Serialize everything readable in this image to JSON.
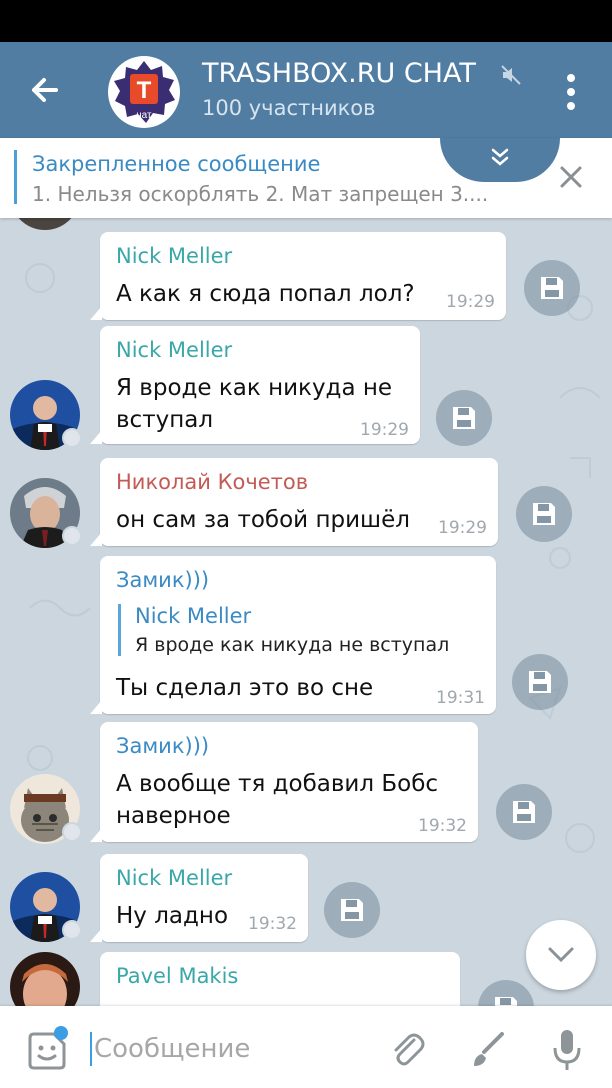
{
  "header": {
    "title": "TRASHBOX.RU CHAT",
    "subtitle": "100 участников",
    "avatar_letter": "T",
    "avatar_caption": "чат"
  },
  "pinned": {
    "title": "Закрепленное сообщение",
    "text": "1. Нельзя оскорблять 2. Мат запрещен 3...."
  },
  "messages": [
    {
      "author": "Nick Meller",
      "text": "А как я сюда попал лол?",
      "time": "19:29",
      "author_color": "#3aa7a8"
    },
    {
      "author": "Nick Meller",
      "text_line1": "Я вроде как никуда не",
      "text_line2": "вступал",
      "time": "19:29",
      "author_color": "#3aa7a8"
    },
    {
      "author": "Николай Кочетов",
      "text": "он сам за тобой пришёл",
      "time": "19:29",
      "author_color": "#c45a55"
    },
    {
      "author": "Замик)))",
      "quote_author": "Nick Meller",
      "quote_text": "Я вроде как никуда не вступал",
      "text": "Ты сделал это во сне",
      "time": "19:31",
      "author_color": "#3a8ac4"
    },
    {
      "author": "Замик)))",
      "text_line1": "А вообще тя добавил Бобс",
      "text_line2": "наверное",
      "time": "19:32",
      "author_color": "#3a8ac4"
    },
    {
      "author": "Nick Meller",
      "text": "Ну ладно",
      "time": "19:32",
      "author_color": "#3aa7a8"
    },
    {
      "author": "Pavel Makis",
      "text": "",
      "time": "",
      "author_color": "#3aa7a8"
    }
  ],
  "composer": {
    "placeholder": "Сообщение"
  },
  "colors": {
    "appbar": "#517da2",
    "accent": "#3b9ee5"
  }
}
